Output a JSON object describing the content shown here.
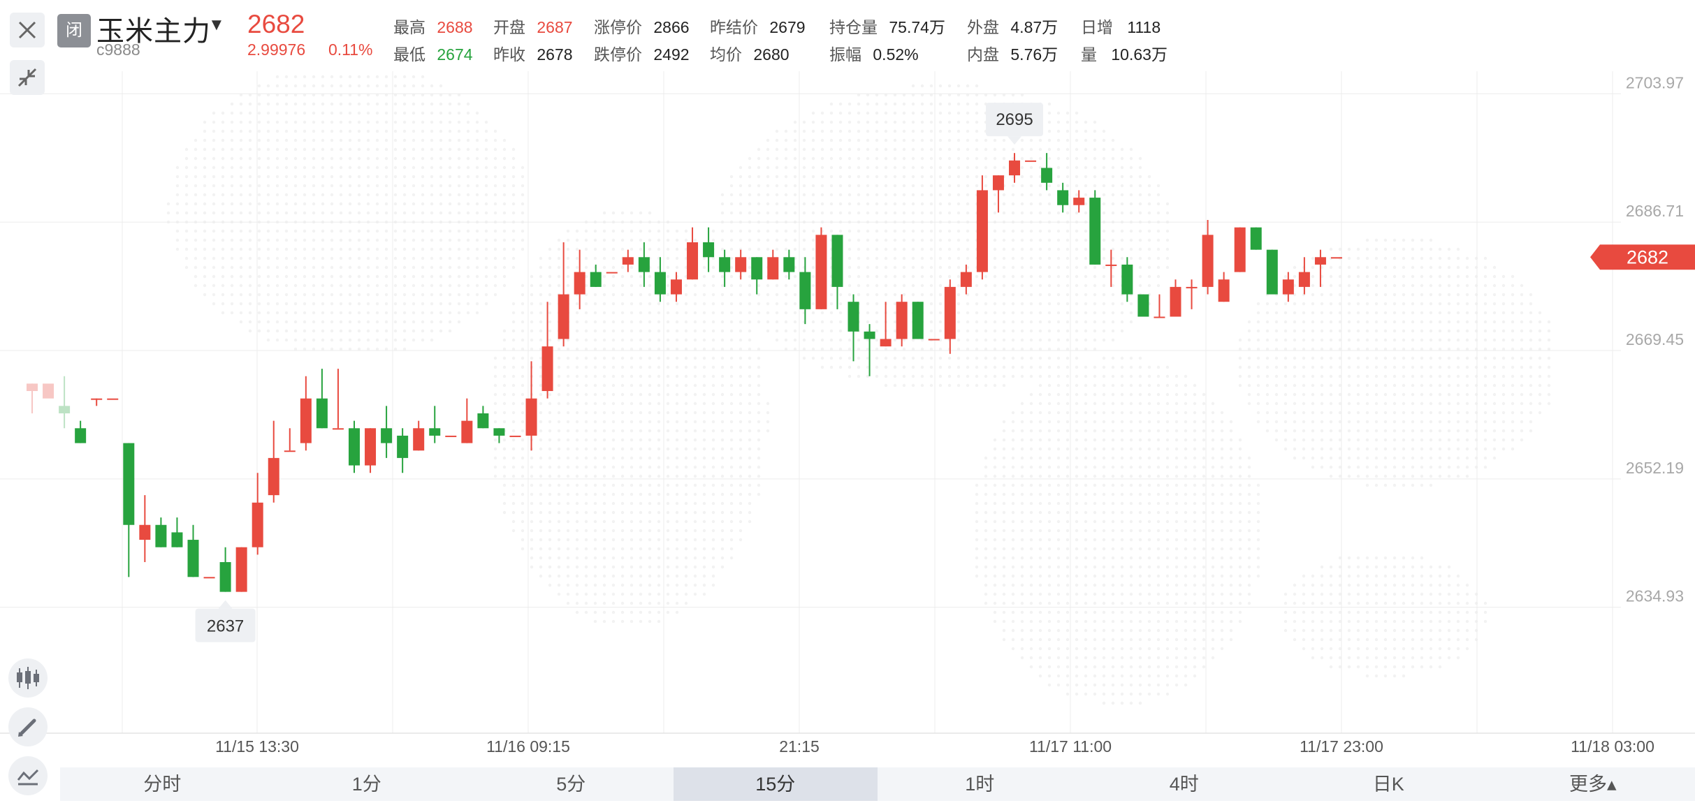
{
  "header": {
    "status_badge": "闭",
    "instrument_name": "玉米主力",
    "instrument_code": "c9888",
    "last_price": "2682",
    "change_abs": "2.99976",
    "change_pct": "0.11%",
    "quote_fields": [
      {
        "label": "最高",
        "value": "2688",
        "color": "red"
      },
      {
        "label": "开盘",
        "value": "2687",
        "color": "red"
      },
      {
        "label": "涨停价",
        "value": "2866",
        "color": "dark"
      },
      {
        "label": "昨结价",
        "value": "2679",
        "color": "dark"
      },
      {
        "label": "持仓量",
        "value": "75.74万",
        "color": "dark"
      },
      {
        "label": "外盘",
        "value": "4.87万",
        "color": "dark"
      },
      {
        "label": "日增",
        "value": "1118",
        "color": "dark"
      },
      {
        "label": "最低",
        "value": "2674",
        "color": "green"
      },
      {
        "label": "昨收",
        "value": "2678",
        "color": "dark"
      },
      {
        "label": "跌停价",
        "value": "2492",
        "color": "dark"
      },
      {
        "label": "均价",
        "value": "2680",
        "color": "dark"
      },
      {
        "label": "振幅",
        "value": "0.52%",
        "color": "dark"
      },
      {
        "label": "内盘",
        "value": "5.76万",
        "color": "dark"
      },
      {
        "label": "量",
        "value": "10.63万",
        "color": "dark"
      }
    ]
  },
  "colors": {
    "up": "#e84a3f",
    "down": "#27a33e",
    "grid": "#ececec",
    "axis_text": "#a8a8a8"
  },
  "icons": {
    "close": "close-icon",
    "shrink": "shrink-icon",
    "caret": "caret-down-icon",
    "candlestick_tool": "candlestick-icon",
    "draw_tool": "pencil-icon",
    "indicator_tool": "indicator-icon"
  },
  "chart_data": {
    "type": "candlestick",
    "interval": "15分",
    "ylim": [
      2618,
      2707
    ],
    "y_ticks": [
      "2703.97",
      "2686.71",
      "2669.45",
      "2652.19",
      "2634.93"
    ],
    "x_tick_labels": [
      "11/15 13:30",
      "11/16 09:15",
      "21:15",
      "11/17 11:00",
      "11/17 23:00",
      "11/18 03:00"
    ],
    "grid": true,
    "current_price": "2682",
    "high_marker": "2695",
    "low_marker": "2637",
    "candles": [
      [
        2664,
        2665,
        2661,
        2665
      ],
      [
        2663,
        2665,
        2663,
        2663
      ],
      [
        2662,
        2661,
        2659,
        2666
      ],
      [
        2659,
        2657,
        2657,
        2660
      ],
      [
        2663,
        2663,
        2662,
        2663
      ],
      [
        2663,
        2663,
        2663,
        2663
      ],
      [
        2657,
        2646,
        2639,
        2657
      ],
      [
        2644,
        2646,
        2641,
        2650
      ],
      [
        2646,
        2643,
        2643,
        2647
      ],
      [
        2645,
        2643,
        2643,
        2647
      ],
      [
        2644,
        2639,
        2639,
        2646
      ],
      [
        2639,
        2639,
        2639,
        2639
      ],
      [
        2641,
        2637,
        2637,
        2643
      ],
      [
        2637,
        2643,
        2637,
        2643
      ],
      [
        2643,
        2649,
        2642,
        2653
      ],
      [
        2650,
        2655,
        2649,
        2660
      ],
      [
        2656,
        2656,
        2656,
        2659
      ],
      [
        2657,
        2663,
        2656,
        2666
      ],
      [
        2663,
        2659,
        2659,
        2667
      ],
      [
        2659,
        2659,
        2659,
        2667
      ],
      [
        2659,
        2654,
        2653,
        2660
      ],
      [
        2654,
        2659,
        2653,
        2659
      ],
      [
        2659,
        2657,
        2655,
        2662
      ],
      [
        2658,
        2655,
        2653,
        2659
      ],
      [
        2656,
        2659,
        2656,
        2660
      ],
      [
        2659,
        2658,
        2657,
        2662
      ],
      [
        2658,
        2658,
        2658,
        2658
      ],
      [
        2657,
        2660,
        2657,
        2663
      ],
      [
        2661,
        2659,
        2659,
        2662
      ],
      [
        2659,
        2658,
        2657,
        2659
      ],
      [
        2658,
        2658,
        2658,
        2658
      ],
      [
        2658,
        2663,
        2656,
        2668
      ],
      [
        2664,
        2670,
        2663,
        2676
      ],
      [
        2671,
        2677,
        2670,
        2684
      ],
      [
        2677,
        2680,
        2675,
        2683
      ],
      [
        2680,
        2678,
        2678,
        2681
      ],
      [
        2680,
        2680,
        2680,
        2680
      ],
      [
        2681,
        2682,
        2680,
        2683
      ],
      [
        2682,
        2680,
        2678,
        2684
      ],
      [
        2680,
        2677,
        2676,
        2682
      ],
      [
        2677,
        2679,
        2676,
        2680
      ],
      [
        2679,
        2684,
        2679,
        2686
      ],
      [
        2684,
        2682,
        2680,
        2686
      ],
      [
        2682,
        2680,
        2678,
        2683
      ],
      [
        2680,
        2682,
        2679,
        2683
      ],
      [
        2682,
        2679,
        2677,
        2682
      ],
      [
        2679,
        2682,
        2679,
        2683
      ],
      [
        2682,
        2680,
        2679,
        2683
      ],
      [
        2680,
        2675,
        2673,
        2682
      ],
      [
        2675,
        2685,
        2675,
        2686
      ],
      [
        2685,
        2678,
        2675,
        2685
      ],
      [
        2676,
        2672,
        2668,
        2677
      ],
      [
        2672,
        2671,
        2666,
        2673
      ],
      [
        2670,
        2671,
        2670,
        2676
      ],
      [
        2671,
        2676,
        2670,
        2677
      ],
      [
        2676,
        2671,
        2671,
        2676
      ],
      [
        2671,
        2671,
        2671,
        2671
      ],
      [
        2671,
        2678,
        2669,
        2679
      ],
      [
        2678,
        2680,
        2677,
        2681
      ],
      [
        2680,
        2691,
        2679,
        2693
      ],
      [
        2691,
        2693,
        2688,
        2693
      ],
      [
        2693,
        2695,
        2692,
        2696
      ],
      [
        2695,
        2695,
        2695,
        2695
      ],
      [
        2694,
        2692,
        2691,
        2696
      ],
      [
        2691,
        2689,
        2688,
        2692
      ],
      [
        2689,
        2690,
        2688,
        2691
      ],
      [
        2690,
        2681,
        2681,
        2691
      ],
      [
        2681,
        2681,
        2678,
        2683
      ],
      [
        2681,
        2677,
        2676,
        2682
      ],
      [
        2677,
        2674,
        2674,
        2677
      ],
      [
        2674,
        2674,
        2674,
        2677
      ],
      [
        2674,
        2678,
        2674,
        2679
      ],
      [
        2678,
        2678,
        2675,
        2679
      ],
      [
        2678,
        2685,
        2677,
        2687
      ],
      [
        2676,
        2679,
        2676,
        2680
      ],
      [
        2680,
        2686,
        2680,
        2686
      ],
      [
        2686,
        2683,
        2683,
        2686
      ],
      [
        2683,
        2677,
        2677,
        2683
      ],
      [
        2677,
        2679,
        2676,
        2680
      ],
      [
        2678,
        2680,
        2677,
        2682
      ],
      [
        2681,
        2682,
        2678,
        2683
      ],
      [
        2682,
        2682,
        2682,
        2682
      ]
    ]
  },
  "tabs": [
    {
      "label": "分时",
      "active": false
    },
    {
      "label": "1分",
      "active": false
    },
    {
      "label": "5分",
      "active": false
    },
    {
      "label": "15分",
      "active": true
    },
    {
      "label": "1时",
      "active": false
    },
    {
      "label": "4时",
      "active": false
    },
    {
      "label": "日K",
      "active": false
    },
    {
      "label": "更多▴",
      "active": false
    }
  ]
}
